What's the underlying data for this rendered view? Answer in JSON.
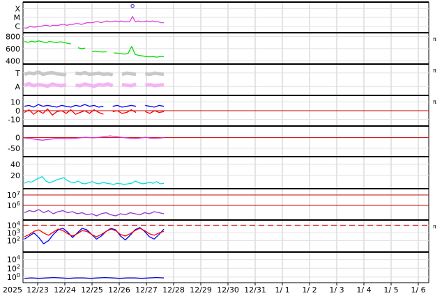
{
  "chart_data": {
    "type": "line",
    "x_start_label": "2025",
    "x_tick_labels": [
      "12/23",
      "12/24",
      "12/25",
      "12/26",
      "12/27",
      "12/28",
      "12/29",
      "12/30",
      "12/31",
      "1/ 1",
      "1/ 2",
      "1/ 3",
      "1/ 4",
      "1/ 5",
      "1/ 6"
    ],
    "side_marker": "π",
    "colors": {
      "xray": "#e040e0",
      "proton_density": "#00e000",
      "speed_light": "#c8c8c8",
      "speed_pink": "#f4b4f4",
      "bz_blue": "#0000ff",
      "bz_red": "#ff0000",
      "bx": "#dd33dd",
      "bt": "#00e0e0",
      "electron": "#9933cc",
      "proton_blue": "#0000ff",
      "proton_red": "#ff0000",
      "kp_blue": "#0000cc",
      "ref_red": "#cc0000"
    },
    "panels": [
      {
        "id": "xray",
        "y_labels": [
          "X",
          "M",
          "C"
        ],
        "ylim": [
          0,
          3
        ],
        "side_marker": false,
        "series": [
          {
            "name": "",
            "color": "xray",
            "values": [
              0.3,
              0.3,
              0.5,
              0.4,
              0.4,
              0.5,
              0.5,
              0.6,
              0.6,
              0.5,
              0.6,
              0.6,
              0.6,
              0.7,
              0.7,
              0.6,
              0.7,
              0.7,
              0.8,
              0.8,
              0.7,
              0.8,
              0.9,
              0.9,
              0.9,
              1.0,
              1.0,
              0.9,
              1.0,
              1.1,
              1.0,
              1.0,
              1.1,
              1.0,
              1.1,
              1.0,
              1.0,
              1.0,
              1.6,
              1.0,
              1.1,
              1.0,
              1.0,
              1.1,
              1.0,
              1.1,
              1.0,
              1.0,
              0.9,
              0.9
            ]
          }
        ],
        "points": [
          {
            "x": 38,
            "y": 2.8
          }
        ]
      },
      {
        "id": "density",
        "y_ticks": [
          400,
          600,
          800
        ],
        "ylim": [
          380,
          830
        ],
        "side_marker": true,
        "series": [
          {
            "name": "",
            "color": "proton_density",
            "values": [
              720,
              705,
              725,
              710,
              730,
              715,
              700,
              720,
              710,
              700,
              715,
              705,
              690,
              680,
              null,
              615,
              600,
              610,
              null,
              555,
              560,
              550,
              545,
              550,
              null,
              530,
              525,
              520,
              510,
              520,
              640,
              505,
              490,
              480,
              470,
              465,
              470,
              460,
              470,
              470
            ]
          }
        ]
      },
      {
        "id": "speed",
        "y_labels": [
          "T",
          "A"
        ],
        "ylim": [
          0,
          1
        ],
        "side_marker": true,
        "series": [
          {
            "name": "",
            "color": "speed_light",
            "values": [
              0.7,
              0.75,
              0.72,
              0.78,
              0.7,
              0.74,
              0.76,
              0.72,
              0.7,
              0.68,
              null,
              0.74,
              0.72,
              0.76,
              0.7,
              0.72,
              0.74,
              0.7,
              0.72,
              0.68,
              null,
              0.7,
              0.74,
              0.72,
              0.7,
              null,
              0.72,
              0.7,
              0.74,
              0.72,
              0.7
            ]
          },
          {
            "name": "",
            "color": "speed_pink",
            "values": [
              0.3,
              0.35,
              0.28,
              0.32,
              0.3,
              0.26,
              0.34,
              0.3,
              0.28,
              0.32,
              null,
              0.3,
              0.28,
              0.34,
              0.3,
              0.26,
              0.32,
              0.3,
              0.34,
              0.28,
              null,
              0.32,
              0.3,
              0.28,
              0.34,
              null,
              0.3,
              0.32,
              0.28,
              0.3,
              0.32
            ]
          }
        ]
      },
      {
        "id": "bz",
        "y_ticks": [
          -10,
          0,
          10
        ],
        "ylim": [
          -15,
          15
        ],
        "side_marker": true,
        "ref_line": 0,
        "series": [
          {
            "name": "",
            "color": "bz_blue",
            "values": [
              5,
              6,
              4,
              7,
              5,
              6,
              5,
              4,
              6,
              5,
              4,
              6,
              5,
              7,
              5,
              6,
              4,
              5,
              null,
              5,
              6,
              4,
              5,
              6,
              5,
              null,
              6,
              5,
              4,
              6,
              5
            ]
          },
          {
            "name": "",
            "color": "bz_red",
            "values": [
              -2,
              1,
              -4,
              0,
              -3,
              2,
              -5,
              -1,
              0,
              -3,
              1,
              -4,
              -2,
              0,
              -3,
              1,
              -2,
              -4,
              null,
              -1,
              0,
              -3,
              -2,
              1,
              -2,
              null,
              -1,
              -3,
              0,
              -2,
              -1
            ]
          }
        ]
      },
      {
        "id": "bx",
        "y_ticks": [
          -50,
          0
        ],
        "ylim": [
          -80,
          45
        ],
        "side_marker": false,
        "ref_line": 0,
        "series": [
          {
            "name": "",
            "color": "bx",
            "values": [
              -2,
              -3,
              -5,
              -8,
              -10,
              -12,
              -10,
              -8,
              -6,
              -5,
              -4,
              -5,
              -6,
              -5,
              -4,
              -2,
              0,
              2,
              1,
              -1,
              0,
              2,
              4,
              6,
              8,
              6,
              4,
              2,
              0,
              -2,
              -4,
              -5,
              -3,
              0,
              2,
              -2,
              -4,
              -3,
              -2,
              0
            ]
          }
        ]
      },
      {
        "id": "bt",
        "y_ticks": [
          20,
          40
        ],
        "ylim": [
          0,
          50
        ],
        "side_marker": false,
        "series": [
          {
            "name": "",
            "color": "bt",
            "values": [
              6,
              9,
              8,
              12,
              15,
              18,
              10,
              7,
              9,
              12,
              14,
              16,
              11,
              8,
              7,
              10,
              6,
              5,
              7,
              9,
              6,
              5,
              8,
              6,
              5,
              4,
              6,
              5,
              4,
              5,
              6,
              10,
              7,
              5,
              6,
              8,
              6,
              9,
              5,
              6
            ]
          }
        ]
      },
      {
        "id": "electron",
        "y_ticks": [
          "10^6",
          "10^7"
        ],
        "ylim": [
          4.8,
          7.4
        ],
        "log": true,
        "side_marker": false,
        "ref_lines": [
          6,
          7
        ],
        "series": [
          {
            "name": "",
            "color": "electron",
            "values": [
              5.3,
              5.5,
              5.4,
              5.6,
              5.3,
              5.5,
              5.2,
              5.4,
              5.5,
              5.3,
              5.4,
              5.2,
              5.3,
              5.1,
              5.2,
              5.0,
              5.2,
              5.3,
              5.1,
              5.0,
              5.2,
              5.1,
              5.3,
              5.2,
              5.1,
              5.3,
              5.2,
              5.4,
              5.3,
              5.2
            ]
          }
        ]
      },
      {
        "id": "proton_flux",
        "y_ticks": [
          "10^2",
          "10^3",
          "10^4"
        ],
        "ylim": [
          0.8,
          4.4
        ],
        "log": true,
        "side_marker": true,
        "ref_dashed": 4,
        "series": [
          {
            "name": "",
            "color": "proton_blue",
            "values": [
              2.2,
              2.6,
              3.0,
              2.4,
              1.6,
              2.0,
              2.8,
              3.4,
              3.6,
              3.1,
              2.4,
              3.0,
              3.6,
              3.4,
              2.8,
              2.2,
              2.6,
              3.2,
              3.6,
              3.4,
              2.6,
              2.1,
              2.7,
              3.4,
              3.7,
              3.2,
              2.5,
              2.2,
              2.8,
              3.5
            ]
          },
          {
            "name": "",
            "color": "proton_red",
            "values": [
              2.5,
              2.8,
              3.2,
              3.4,
              3.0,
              2.7,
              3.1,
              3.5,
              3.3,
              2.9,
              2.6,
              2.9,
              3.3,
              3.2,
              2.8,
              2.5,
              2.8,
              3.2,
              3.5,
              3.3,
              2.8,
              2.6,
              2.9,
              3.3,
              3.6,
              3.3,
              2.9,
              2.7,
              3.0,
              3.2
            ]
          }
        ]
      },
      {
        "id": "kp",
        "y_ticks": [
          "10^0",
          "10^2",
          "10^4"
        ],
        "ylim": [
          -0.8,
          5.2
        ],
        "log": true,
        "side_marker": false,
        "series": [
          {
            "name": "",
            "color": "kp_blue",
            "values": [
              -0.3,
              -0.2,
              -0.3,
              -0.2,
              -0.1,
              -0.2,
              -0.3,
              -0.2,
              -0.2,
              -0.3,
              -0.2,
              -0.1,
              -0.2,
              -0.3,
              -0.2,
              -0.2,
              -0.3,
              -0.2,
              -0.1,
              -0.2
            ]
          }
        ]
      }
    ]
  }
}
